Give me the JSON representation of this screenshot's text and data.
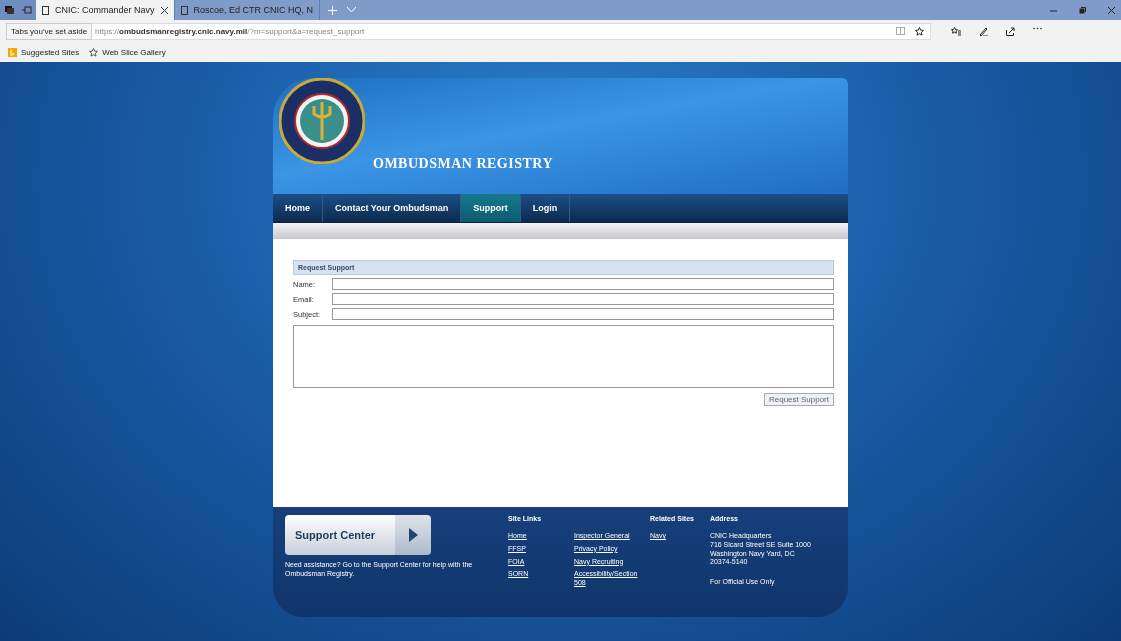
{
  "browser": {
    "tabs": [
      {
        "title": "CNIC: Commander Navy",
        "selected": true
      },
      {
        "title": "Roscoe, Ed CTR CNIC HQ, N",
        "selected": false
      }
    ],
    "tooltip": "Tabs you've set aside",
    "url": "https://**ombudsmanregistry.cnic.navy.mil**/?m=support&a=request_support",
    "favorites": [
      {
        "label": "Suggested Sites",
        "kind": "bing"
      },
      {
        "label": "Web Slice Gallery",
        "kind": "star"
      }
    ]
  },
  "page": {
    "site_title": "OMBUDSMAN REGISTRY",
    "nav": [
      {
        "label": "Home",
        "selected": false
      },
      {
        "label": "Contact Your Ombudsman",
        "selected": false
      },
      {
        "label": "Support",
        "selected": true
      },
      {
        "label": "Login",
        "selected": false
      }
    ],
    "form": {
      "heading": "Request Support",
      "fields": [
        {
          "label": "Name:"
        },
        {
          "label": "Email:"
        },
        {
          "label": "Subject:"
        }
      ],
      "submit": "Request Support"
    },
    "footer": {
      "support_button": "Support Center",
      "support_text": "Need assistance? Go to the Support Center for help with the Ombudsman Registry.",
      "site_links": {
        "heading": "Site Links",
        "links": [
          "Home",
          "FFSP",
          "FOIA",
          "SORN",
          "Inspector General",
          "Privacy Policy",
          "Navy Recruiting",
          "Accessibility/Section 508"
        ]
      },
      "related_sites": {
        "heading": "Related Sites",
        "links": [
          "Navy"
        ]
      },
      "address": {
        "heading": "Address",
        "lines": [
          "CNIC Headquarters",
          "716 Sicard Street SE Suite 1000",
          "Washington Navy Yard, DC",
          "20374-5140"
        ],
        "note": "For Official Use Only"
      }
    }
  }
}
